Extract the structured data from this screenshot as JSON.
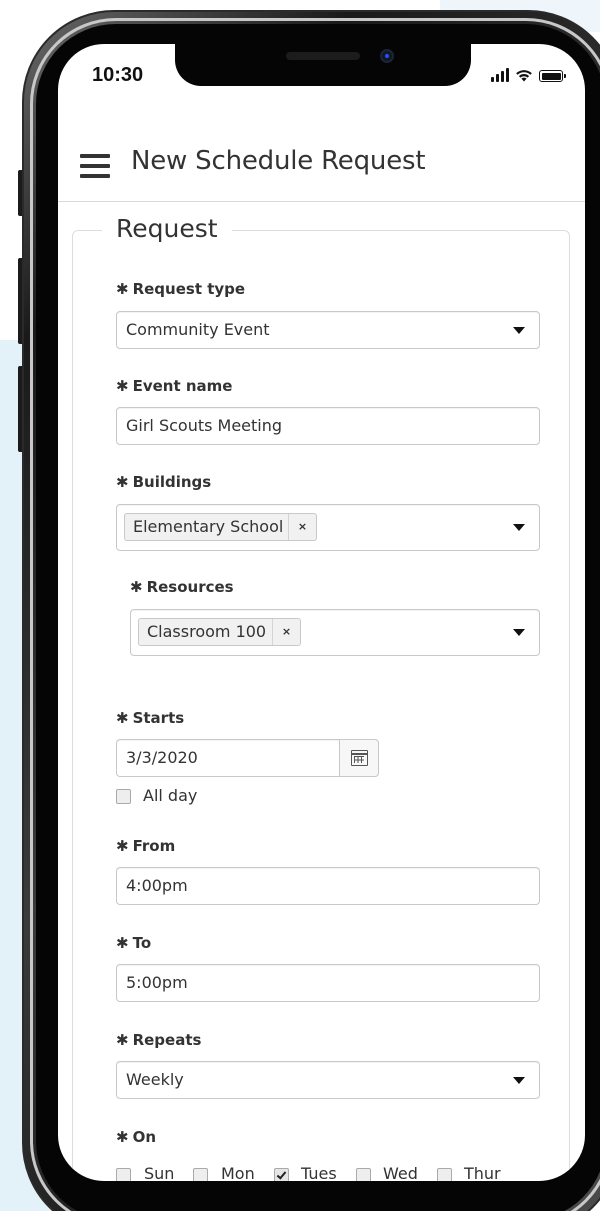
{
  "status_bar": {
    "time": "10:30"
  },
  "header": {
    "title": "New Schedule Request"
  },
  "form": {
    "legend": "Request",
    "required_marker": "✱",
    "request_type": {
      "label": "Request type",
      "value": "Community Event"
    },
    "event_name": {
      "label": "Event name",
      "value": "Girl Scouts Meeting"
    },
    "buildings": {
      "label": "Buildings",
      "tags": [
        "Elementary School"
      ]
    },
    "resources": {
      "label": "Resources",
      "tags": [
        "Classroom 100"
      ]
    },
    "starts": {
      "label": "Starts",
      "value": "3/3/2020"
    },
    "all_day": {
      "label": "All day",
      "checked": false
    },
    "from": {
      "label": "From",
      "value": "4:00pm"
    },
    "to": {
      "label": "To",
      "value": "5:00pm"
    },
    "repeats": {
      "label": "Repeats",
      "value": "Weekly"
    },
    "on": {
      "label": "On",
      "days": [
        {
          "label": "Sun",
          "checked": false
        },
        {
          "label": "Mon",
          "checked": false
        },
        {
          "label": "Tues",
          "checked": true
        },
        {
          "label": "Wed",
          "checked": false
        },
        {
          "label": "Thur",
          "checked": false
        }
      ]
    },
    "tag_remove": "×"
  }
}
